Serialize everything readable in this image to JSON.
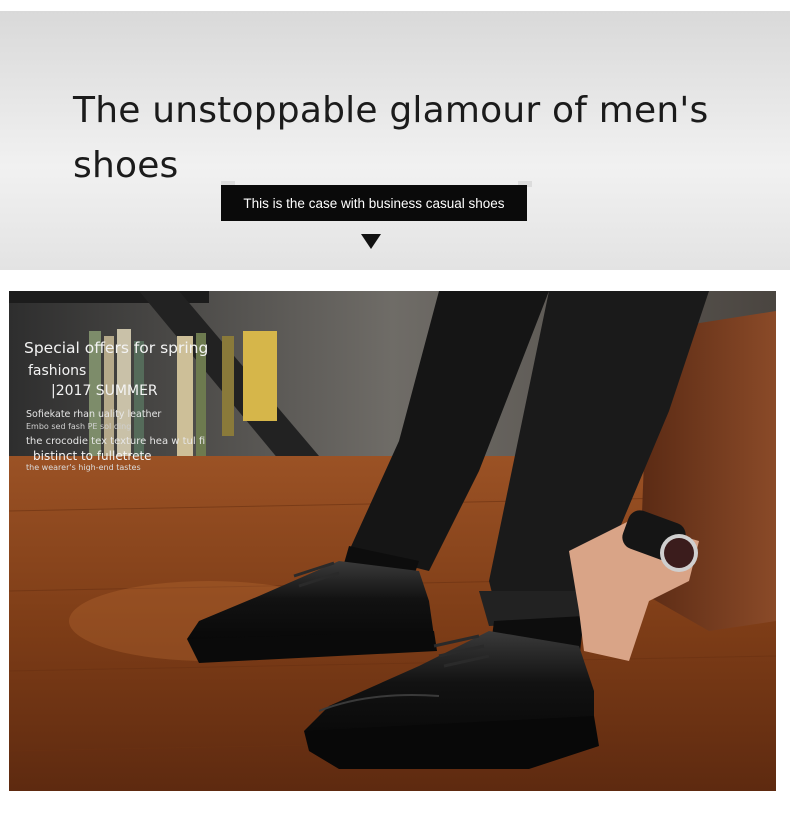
{
  "banner": {
    "headline": "The unstoppable glamour of men's shoes",
    "tagline": "This is the case with business casual shoes"
  },
  "overlay": {
    "title": "Special offers for spring",
    "subtitle": "fashions",
    "season": "|2017 SUMMER",
    "line1": "Sofiekate rhan uality leather",
    "line2": "Embo sed fash PE sol ding",
    "line3": "the crocodie tex texture hea w tul fi",
    "line4": "bistinct to fulletrete",
    "line5": "the wearer's high-end tastes"
  },
  "colors": {
    "banner_bg": "#e6e6e6",
    "tagline_bg": "#0a0a0a",
    "floor": "#8a4520"
  },
  "icons": [
    "down-arrow-icon"
  ]
}
